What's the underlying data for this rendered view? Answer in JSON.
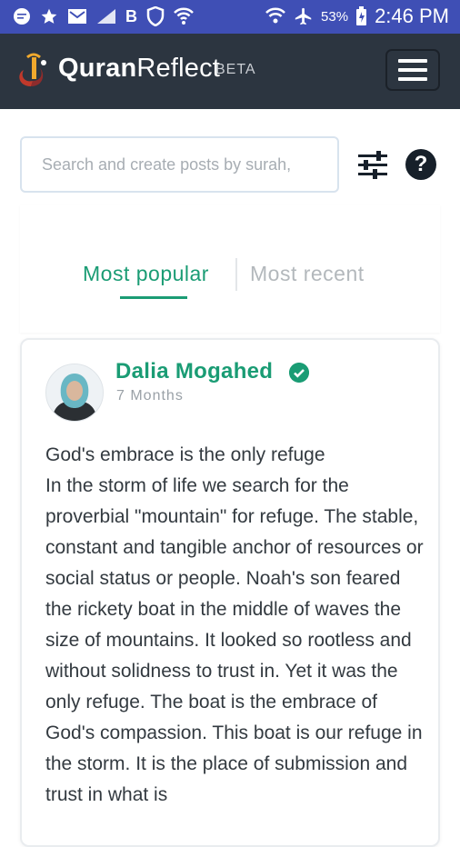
{
  "status_bar": {
    "time": "2:46 PM",
    "battery": "53%",
    "left_icons": [
      "chat-bubble-icon",
      "star-icon",
      "email-icon",
      "signal-icon",
      "b-icon",
      "shield-icon",
      "wifi-icon"
    ],
    "b_label": "B"
  },
  "app": {
    "brand_bold": "Quran",
    "brand_light": "Reflect",
    "beta": "BETA"
  },
  "search": {
    "placeholder": "Search and create posts by surah,"
  },
  "tabs": {
    "popular": "Most popular",
    "recent": "Most recent"
  },
  "post": {
    "author": "Dalia Mogahed",
    "time": "7 Months",
    "title": "God's embrace is the only refuge",
    "body": "In the storm of life we search for the proverbial \"mountain\" for refuge. The stable, constant and tangible anchor of resources or social status or people. Noah's son feared the rickety boat in the middle of waves the size of mountains. It looked so rootless and without solidness to trust in. Yet it was the only refuge. The boat is the embrace of God's compassion. This boat is our refuge in the storm. It is the place of submission and trust in what is"
  },
  "colors": {
    "status_bar": "#3f4fb5",
    "app_bar": "#2c3540",
    "accent": "#1a9c74"
  }
}
